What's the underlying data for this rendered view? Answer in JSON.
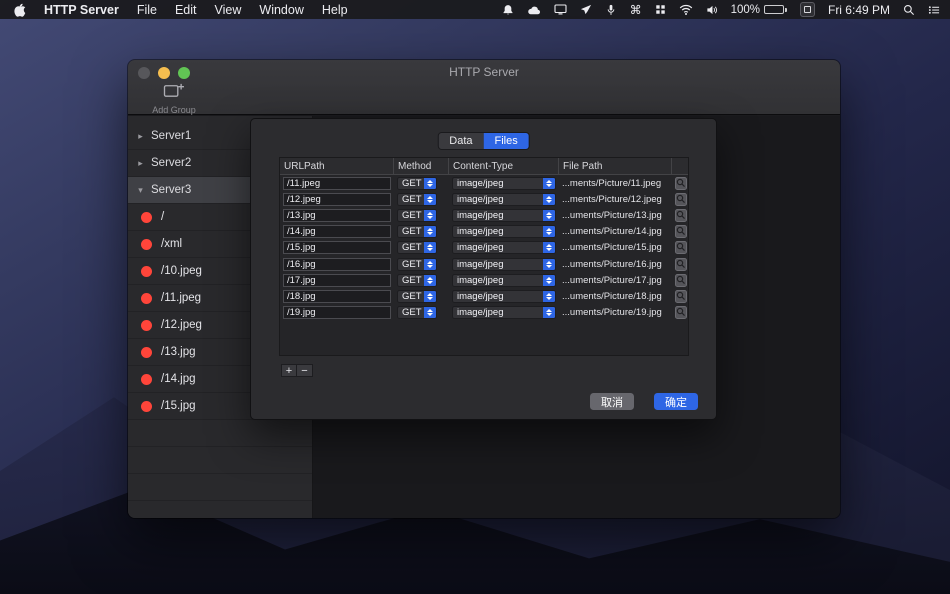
{
  "colors": {
    "accent": "#2e66e5",
    "record_red": "#ff453a"
  },
  "menu_bar": {
    "app_name": "HTTP Server",
    "menus": [
      "File",
      "Edit",
      "View",
      "Window",
      "Help"
    ],
    "battery": "100%",
    "clock": "Fri 6:49 PM",
    "status_icons": [
      "bell",
      "cloud",
      "display",
      "paper-plane",
      "microphone",
      "command",
      "grid",
      "wifi",
      "volume",
      "battery",
      "app",
      "search",
      "list"
    ]
  },
  "window": {
    "title": "HTTP Server",
    "toolbar": {
      "add_group": "Add Group"
    },
    "sidebar": {
      "servers": [
        {
          "label": "Server1",
          "expanded": false,
          "selected": false
        },
        {
          "label": "Server2",
          "expanded": false,
          "selected": false
        },
        {
          "label": "Server3",
          "expanded": true,
          "selected": true
        }
      ],
      "routes": [
        "/",
        "/xml",
        "/10.jpeg",
        "/11.jpeg",
        "/12.jpeg",
        "/13.jpg",
        "/14.jpg",
        "/15.jpg"
      ],
      "empty_rows": 4
    }
  },
  "sheet": {
    "tabs": [
      {
        "label": "Data",
        "active": false
      },
      {
        "label": "Files",
        "active": true
      }
    ],
    "table": {
      "columns": [
        "URLPath",
        "Method",
        "Content-Type",
        "File Path"
      ],
      "rows": [
        {
          "url_path": "/11.jpeg",
          "method": "GET",
          "content_type": "image/jpeg",
          "file_path": "...ments/Picture/11.jpeg"
        },
        {
          "url_path": "/12.jpeg",
          "method": "GET",
          "content_type": "image/jpeg",
          "file_path": "...ments/Picture/12.jpeg"
        },
        {
          "url_path": "/13.jpg",
          "method": "GET",
          "content_type": "image/jpeg",
          "file_path": "...uments/Picture/13.jpg"
        },
        {
          "url_path": "/14.jpg",
          "method": "GET",
          "content_type": "image/jpeg",
          "file_path": "...uments/Picture/14.jpg"
        },
        {
          "url_path": "/15.jpg",
          "method": "GET",
          "content_type": "image/jpeg",
          "file_path": "...uments/Picture/15.jpg"
        },
        {
          "url_path": "/16.jpg",
          "method": "GET",
          "content_type": "image/jpeg",
          "file_path": "...uments/Picture/16.jpg"
        },
        {
          "url_path": "/17.jpg",
          "method": "GET",
          "content_type": "image/jpeg",
          "file_path": "...uments/Picture/17.jpg"
        },
        {
          "url_path": "/18.jpg",
          "method": "GET",
          "content_type": "image/jpeg",
          "file_path": "...uments/Picture/18.jpg"
        },
        {
          "url_path": "/19.jpg",
          "method": "GET",
          "content_type": "image/jpeg",
          "file_path": "...uments/Picture/19.jpg"
        }
      ]
    },
    "add_button": "+",
    "remove_button": "−",
    "cancel_label": "取消",
    "ok_label": "确定"
  }
}
